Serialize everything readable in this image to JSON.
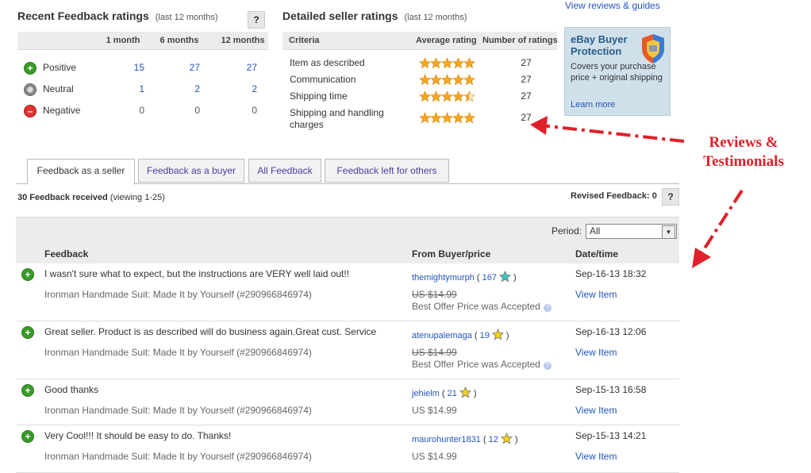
{
  "recent": {
    "title": "Recent Feedback ratings",
    "subtitle": "(last 12 months)",
    "help": "?",
    "cols": [
      "1 month",
      "6 months",
      "12 months"
    ],
    "rows": [
      {
        "label": "Positive",
        "v": [
          "15",
          "27",
          "27"
        ]
      },
      {
        "label": "Neutral",
        "v": [
          "1",
          "2",
          "2"
        ]
      },
      {
        "label": "Negative",
        "v": [
          "0",
          "0",
          "0"
        ]
      }
    ]
  },
  "dsr": {
    "title": "Detailed seller ratings",
    "subtitle": "(last 12 months)",
    "cols": [
      "Criteria",
      "Average rating",
      "Number of ratings"
    ],
    "rows": [
      {
        "label": "Item as described",
        "rating": 5,
        "count": "27"
      },
      {
        "label": "Communication",
        "rating": 5,
        "count": "27"
      },
      {
        "label": "Shipping time",
        "rating": 4.5,
        "count": "27"
      },
      {
        "label": "Shipping and handling charges",
        "rating": 5,
        "count": "27"
      }
    ]
  },
  "view_reviews": "View reviews & guides",
  "promo": {
    "title": "eBay Buyer Protection",
    "body": "Covers your purchase price + original shipping",
    "link": "Learn more"
  },
  "annotation": "Reviews & Testimonials",
  "tabs": [
    "Feedback as a seller",
    "Feedback as a buyer",
    "All Feedback",
    "Feedback left for others"
  ],
  "summary": {
    "received": "30 Feedback received",
    "viewing": "(viewing 1-25)",
    "revised": "Revised Feedback: 0",
    "help": "?"
  },
  "period": {
    "label": "Period:",
    "value": "All"
  },
  "table_headers": [
    "Feedback",
    "From Buyer/price",
    "Date/time"
  ],
  "feedback": [
    {
      "comment": "I wasn't sure what to expect, but the instructions are VERY well laid out!!",
      "item": "Ironman Handmade Suit: Made It by Yourself (#290966846974)",
      "buyer": "themightymurph",
      "score": "167",
      "star": "#3cc6c6",
      "price": "US $14.99",
      "struck": true,
      "note": "Best Offer Price was Accepted",
      "date": "Sep-16-13 18:32",
      "view": "View Item"
    },
    {
      "comment": "Great seller. Product is as described will do business again.Great cust. Service",
      "item": "Ironman Handmade Suit: Made It by Yourself (#290966846974)",
      "buyer": "atenupalemaga",
      "score": "19",
      "star": "#f5d31a",
      "price": "US $14.99",
      "struck": true,
      "note": "Best Offer Price was Accepted",
      "date": "Sep-16-13 12:06",
      "view": "View Item"
    },
    {
      "comment": "Good thanks",
      "item": "Ironman Handmade Suit: Made It by Yourself (#290966846974)",
      "buyer": "jehielm",
      "score": "21",
      "star": "#f5d31a",
      "price": "US $14.99",
      "struck": false,
      "note": "",
      "date": "Sep-15-13 16:58",
      "view": "View Item"
    },
    {
      "comment": "Very Cool!!! It should be easy to do. Thanks!",
      "item": "Ironman Handmade Suit: Made It by Yourself (#290966846974)",
      "buyer": "maurohunter1831",
      "score": "12",
      "star": "#f5d31a",
      "price": "US $14.99",
      "struck": false,
      "note": "",
      "date": "Sep-15-13 14:21",
      "view": "View Item"
    }
  ],
  "colors": {
    "link": "#2255bb",
    "annotation": "#e0202a",
    "star_fill": "#f5a623",
    "positive": "#3a9a2a",
    "negative": "#d33333"
  }
}
